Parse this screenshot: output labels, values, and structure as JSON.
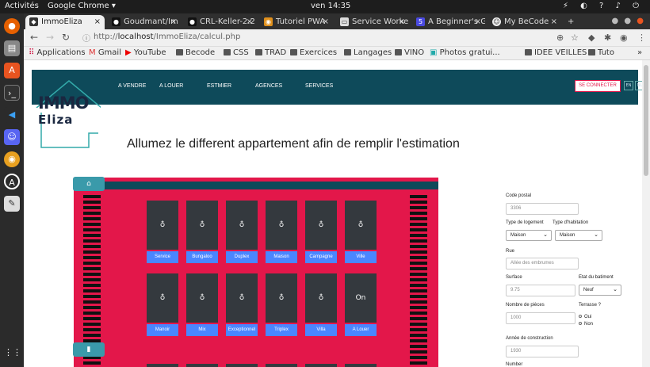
{
  "os": {
    "activities": "Activités",
    "app_name": "Google Chrome ▾",
    "clock": "ven 14:35"
  },
  "browser": {
    "tabs": [
      {
        "label": "ImmoEliza",
        "active": true
      },
      {
        "label": "Goudmant/Im"
      },
      {
        "label": "CRL-Keller-2.2"
      },
      {
        "label": "Tutoriel PWA"
      },
      {
        "label": "Service Worke"
      },
      {
        "label": "A Beginner's G"
      },
      {
        "label": "My BeCode"
      }
    ],
    "url_prefix": "http://",
    "url_host": "localhost",
    "url_path": "/ImmoEliza/calcul.php",
    "bookmarks": [
      "Applications",
      "Gmail",
      "YouTube",
      "Becode",
      "CSS",
      "TRAD",
      "Exercices",
      "Langages",
      "VINO",
      "Photos gratui...",
      "IDEE VEILLES",
      "Tuto"
    ]
  },
  "site": {
    "logo_line1": "IMMO",
    "logo_line2": "Eliza",
    "nav": [
      "A VENDRE",
      "A LOUER",
      "ESTMIER",
      "AGENCES",
      "SERVICES"
    ],
    "login": "SE CONNECTER",
    "langs": [
      "EN",
      "NL"
    ],
    "headline": "Allumez le different appartement afin de remplir l'estimation"
  },
  "building": {
    "row1_windows": [
      "♁",
      "♁",
      "♁",
      "♁",
      "♁",
      "♁"
    ],
    "row1_buttons": [
      "Service",
      "Bungaloo",
      "Duplex",
      "Maison",
      "Campagne",
      "Ville"
    ],
    "row2_windows": [
      "♁",
      "♁",
      "♁",
      "♁",
      "♁",
      "On"
    ],
    "row2_buttons": [
      "Manoir",
      "Mix",
      "Exceptionnel",
      "Triplex",
      "Villa",
      "A Louer"
    ]
  },
  "form": {
    "code_postal_label": "Code postal",
    "code_postal_value": "3306",
    "type_logement_label": "Type de logement",
    "type_habitation_label": "Type d'habitation",
    "type_logement_value": "Maison",
    "type_habitation_value": "Maison",
    "rue_label": "Rue",
    "rue_placeholder": "Allée des embrumes",
    "surface_label": "Surface",
    "surface_value": "9.75",
    "etat_label": "Etat du batiment",
    "etat_value": "Neuf",
    "pieces_label": "Nombre de pièces",
    "pieces_value": "1000",
    "terrasse_label": "Terrasse ?",
    "terrasse_oui": "Oui",
    "terrasse_non": "Non",
    "annee_label": "Année de construction",
    "annee_value": "1930",
    "number_label": "Number"
  }
}
